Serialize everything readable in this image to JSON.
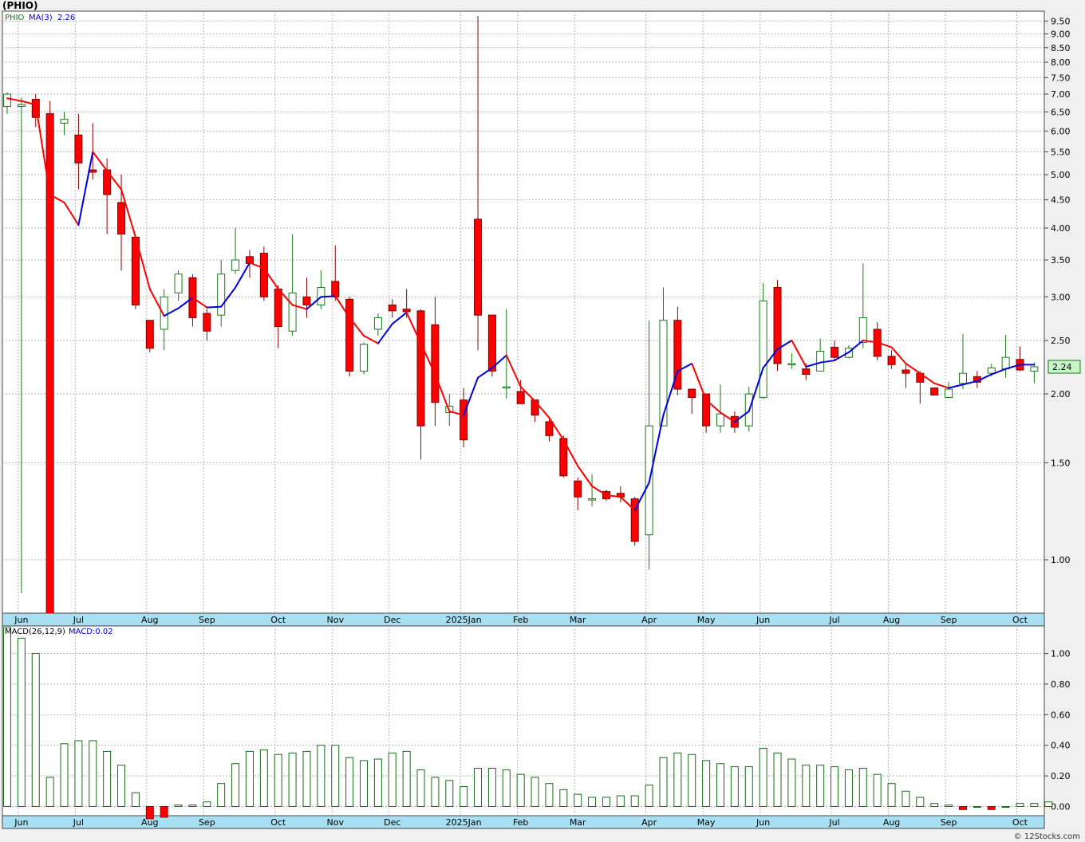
{
  "header": {
    "ticker_label": "(PHIO)"
  },
  "footer": {
    "credit": "© 12Stocks.com"
  },
  "chart_data": [
    {
      "type": "candlestick",
      "legend": {
        "symbol": "PHIO",
        "ma_label": "MA(3)",
        "ma_value": "2.26"
      },
      "last_price_label": "2.24",
      "scale": "log",
      "ylim": [
        0.8,
        9.9
      ],
      "y_ticks": [
        1.0,
        1.5,
        2.0,
        2.5,
        3.0,
        3.5,
        4.0,
        4.5,
        5.0,
        5.5,
        6.0,
        6.5,
        7.0,
        7.5,
        8.0,
        8.5,
        9.0,
        9.5
      ],
      "y_tick_labels": [
        "1.00",
        "1.50",
        "2.00",
        "2.50",
        "3.00",
        "3.50",
        "4.00",
        "4.50",
        "5.00",
        "5.50",
        "6.00",
        "6.50",
        "7.00",
        "7.50",
        "8.00",
        "8.50",
        "9.00",
        "9.50"
      ],
      "x_labels": [
        {
          "label": "Jun",
          "week": 1
        },
        {
          "label": "Jul",
          "week": 5
        },
        {
          "label": "Aug",
          "week": 10
        },
        {
          "label": "Sep",
          "week": 14
        },
        {
          "label": "Oct",
          "week": 19
        },
        {
          "label": "Nov",
          "week": 23
        },
        {
          "label": "Dec",
          "week": 27
        },
        {
          "label": "2025Jan",
          "week": 32
        },
        {
          "label": "Feb",
          "week": 36
        },
        {
          "label": "Mar",
          "week": 40
        },
        {
          "label": "Apr",
          "week": 45
        },
        {
          "label": "May",
          "week": 49
        },
        {
          "label": "Jun",
          "week": 53
        },
        {
          "label": "Jul",
          "week": 58
        },
        {
          "label": "Aug",
          "week": 62
        },
        {
          "label": "Sep",
          "week": 66
        },
        {
          "label": "Oct",
          "week": 71
        }
      ],
      "ohlc": [
        {
          "o": 6.65,
          "h": 7.05,
          "l": 6.45,
          "c": 7.0
        },
        {
          "o": 6.65,
          "h": 6.9,
          "l": 0.87,
          "c": 6.7
        },
        {
          "o": 6.85,
          "h": 7.0,
          "l": 6.1,
          "c": 6.35
        },
        {
          "o": 6.45,
          "h": 6.8,
          "l": 0.75,
          "c": 0.75
        },
        {
          "o": 6.2,
          "h": 6.5,
          "l": 5.9,
          "c": 6.3
        },
        {
          "o": 5.9,
          "h": 6.45,
          "l": 4.7,
          "c": 5.25
        },
        {
          "o": 5.1,
          "h": 6.2,
          "l": 4.9,
          "c": 5.05
        },
        {
          "o": 5.1,
          "h": 5.35,
          "l": 3.9,
          "c": 4.6
        },
        {
          "o": 4.45,
          "h": 5.0,
          "l": 3.35,
          "c": 3.9
        },
        {
          "o": 3.85,
          "h": 3.85,
          "l": 2.85,
          "c": 2.9
        },
        {
          "o": 2.72,
          "h": 2.72,
          "l": 2.38,
          "c": 2.42
        },
        {
          "o": 2.62,
          "h": 3.1,
          "l": 2.4,
          "c": 3.0
        },
        {
          "o": 3.05,
          "h": 3.35,
          "l": 2.95,
          "c": 3.3
        },
        {
          "o": 3.25,
          "h": 3.3,
          "l": 2.65,
          "c": 2.75
        },
        {
          "o": 2.8,
          "h": 2.85,
          "l": 2.5,
          "c": 2.6
        },
        {
          "o": 2.78,
          "h": 3.5,
          "l": 2.65,
          "c": 3.3
        },
        {
          "o": 3.35,
          "h": 4.0,
          "l": 3.3,
          "c": 3.5
        },
        {
          "o": 3.55,
          "h": 3.65,
          "l": 3.25,
          "c": 3.45
        },
        {
          "o": 3.6,
          "h": 3.7,
          "l": 2.95,
          "c": 3.0
        },
        {
          "o": 3.1,
          "h": 3.15,
          "l": 2.42,
          "c": 2.65
        },
        {
          "o": 2.6,
          "h": 3.9,
          "l": 2.55,
          "c": 3.05
        },
        {
          "o": 3.0,
          "h": 3.25,
          "l": 2.75,
          "c": 2.9
        },
        {
          "o": 2.9,
          "h": 3.35,
          "l": 2.85,
          "c": 3.12
        },
        {
          "o": 3.2,
          "h": 3.72,
          "l": 2.95,
          "c": 3.0
        },
        {
          "o": 2.97,
          "h": 3.0,
          "l": 2.15,
          "c": 2.2
        },
        {
          "o": 2.2,
          "h": 2.48,
          "l": 2.17,
          "c": 2.46
        },
        {
          "o": 2.62,
          "h": 2.8,
          "l": 2.55,
          "c": 2.75
        },
        {
          "o": 2.9,
          "h": 2.97,
          "l": 2.75,
          "c": 2.83
        },
        {
          "o": 2.85,
          "h": 3.1,
          "l": 2.75,
          "c": 2.82
        },
        {
          "o": 2.83,
          "h": 2.85,
          "l": 1.52,
          "c": 1.75
        },
        {
          "o": 2.67,
          "h": 3.0,
          "l": 1.75,
          "c": 1.93
        },
        {
          "o": 1.85,
          "h": 2.0,
          "l": 1.75,
          "c": 1.9
        },
        {
          "o": 1.95,
          "h": 2.05,
          "l": 1.6,
          "c": 1.65
        },
        {
          "o": 4.15,
          "h": 9.7,
          "l": 2.4,
          "c": 2.78
        },
        {
          "o": 2.78,
          "h": 2.78,
          "l": 2.15,
          "c": 2.2
        },
        {
          "o": 2.06,
          "h": 2.85,
          "l": 1.96,
          "c": 2.06
        },
        {
          "o": 2.02,
          "h": 2.12,
          "l": 1.92,
          "c": 1.92
        },
        {
          "o": 1.95,
          "h": 1.95,
          "l": 1.78,
          "c": 1.83
        },
        {
          "o": 1.78,
          "h": 1.8,
          "l": 1.64,
          "c": 1.68
        },
        {
          "o": 1.66,
          "h": 1.68,
          "l": 1.41,
          "c": 1.42
        },
        {
          "o": 1.39,
          "h": 1.41,
          "l": 1.23,
          "c": 1.3
        },
        {
          "o": 1.29,
          "h": 1.43,
          "l": 1.25,
          "c": 1.29
        },
        {
          "o": 1.33,
          "h": 1.34,
          "l": 1.28,
          "c": 1.29
        },
        {
          "o": 1.32,
          "h": 1.36,
          "l": 1.27,
          "c": 1.3
        },
        {
          "o": 1.29,
          "h": 1.3,
          "l": 1.06,
          "c": 1.08
        },
        {
          "o": 1.11,
          "h": 2.72,
          "l": 0.96,
          "c": 1.75
        },
        {
          "o": 1.75,
          "h": 3.12,
          "l": 1.75,
          "c": 2.72
        },
        {
          "o": 2.72,
          "h": 2.88,
          "l": 1.99,
          "c": 2.04
        },
        {
          "o": 2.04,
          "h": 2.04,
          "l": 1.84,
          "c": 1.97
        },
        {
          "o": 2.0,
          "h": 2.0,
          "l": 1.7,
          "c": 1.75
        },
        {
          "o": 1.75,
          "h": 2.08,
          "l": 1.7,
          "c": 1.84
        },
        {
          "o": 1.82,
          "h": 1.86,
          "l": 1.7,
          "c": 1.74
        },
        {
          "o": 1.75,
          "h": 2.06,
          "l": 1.71,
          "c": 2.0
        },
        {
          "o": 1.97,
          "h": 3.18,
          "l": 1.96,
          "c": 2.95
        },
        {
          "o": 3.12,
          "h": 3.22,
          "l": 2.2,
          "c": 2.27
        },
        {
          "o": 2.27,
          "h": 2.37,
          "l": 2.22,
          "c": 2.27
        },
        {
          "o": 2.22,
          "h": 2.27,
          "l": 2.12,
          "c": 2.17
        },
        {
          "o": 2.2,
          "h": 2.52,
          "l": 2.2,
          "c": 2.39
        },
        {
          "o": 2.43,
          "h": 2.5,
          "l": 2.3,
          "c": 2.33
        },
        {
          "o": 2.33,
          "h": 2.45,
          "l": 2.32,
          "c": 2.42
        },
        {
          "o": 2.48,
          "h": 3.45,
          "l": 2.42,
          "c": 2.75
        },
        {
          "o": 2.62,
          "h": 2.7,
          "l": 2.3,
          "c": 2.34
        },
        {
          "o": 2.34,
          "h": 2.4,
          "l": 2.22,
          "c": 2.26
        },
        {
          "o": 2.21,
          "h": 2.27,
          "l": 2.05,
          "c": 2.18
        },
        {
          "o": 2.18,
          "h": 2.2,
          "l": 1.92,
          "c": 2.1
        },
        {
          "o": 2.05,
          "h": 2.05,
          "l": 1.99,
          "c": 1.99
        },
        {
          "o": 1.97,
          "h": 2.1,
          "l": 1.97,
          "c": 2.04
        },
        {
          "o": 2.09,
          "h": 2.57,
          "l": 2.04,
          "c": 2.18
        },
        {
          "o": 2.15,
          "h": 2.2,
          "l": 2.05,
          "c": 2.1
        },
        {
          "o": 2.18,
          "h": 2.27,
          "l": 2.15,
          "c": 2.23
        },
        {
          "o": 2.22,
          "h": 2.56,
          "l": 2.14,
          "c": 2.33
        },
        {
          "o": 2.31,
          "h": 2.44,
          "l": 2.2,
          "c": 2.21
        },
        {
          "o": 2.2,
          "h": 2.28,
          "l": 2.09,
          "c": 2.24
        }
      ],
      "ma3": [
        6.88,
        6.8,
        6.7,
        4.6,
        4.45,
        4.05,
        5.5,
        5.08,
        4.7,
        3.85,
        3.1,
        2.77,
        2.86,
        2.99,
        2.87,
        2.88,
        3.12,
        3.46,
        3.38,
        3.1,
        2.9,
        2.85,
        3.0,
        3.01,
        2.75,
        2.55,
        2.47,
        2.68,
        2.81,
        2.47,
        2.17,
        1.86,
        1.83,
        2.14,
        2.23,
        2.35,
        2.06,
        1.94,
        1.81,
        1.65,
        1.48,
        1.36,
        1.31,
        1.3,
        1.23,
        1.38,
        1.83,
        2.2,
        2.27,
        1.95,
        1.85,
        1.78,
        1.86,
        2.23,
        2.41,
        2.5,
        2.24,
        2.28,
        2.3,
        2.38,
        2.5,
        2.48,
        2.43,
        2.27,
        2.18,
        2.09,
        2.05,
        2.08,
        2.11,
        2.17,
        2.22,
        2.26,
        2.26
      ],
      "ma3_colors": [
        "red",
        "red",
        "red",
        "red",
        "red",
        "red",
        "blue",
        "red",
        "red",
        "red",
        "red",
        "red",
        "blue",
        "blue",
        "red",
        "blue",
        "blue",
        "blue",
        "red",
        "red",
        "red",
        "red",
        "blue",
        "blue",
        "red",
        "red",
        "red",
        "blue",
        "blue",
        "red",
        "red",
        "red",
        "red",
        "blue",
        "blue",
        "blue",
        "red",
        "red",
        "red",
        "red",
        "red",
        "red",
        "red",
        "red",
        "red",
        "blue",
        "blue",
        "blue",
        "blue",
        "red",
        "red",
        "red",
        "blue",
        "blue",
        "blue",
        "blue",
        "red",
        "blue",
        "blue",
        "blue",
        "blue",
        "red",
        "red",
        "red",
        "red",
        "red",
        "red",
        "blue",
        "blue",
        "blue",
        "blue",
        "blue",
        "blue"
      ]
    },
    {
      "type": "bar",
      "legend": {
        "label": "MACD(26,12,9)",
        "value_label": "MACD:0.02"
      },
      "ylim": [
        -0.06,
        1.18
      ],
      "y_ticks": [
        0.0,
        0.2,
        0.4,
        0.6,
        0.8,
        1.0
      ],
      "y_tick_labels": [
        "0.00",
        "0.20",
        "0.40",
        "0.60",
        "0.80",
        "1.00"
      ],
      "values": [
        1.17,
        1.1,
        1.0,
        0.19,
        0.41,
        0.43,
        0.43,
        0.36,
        0.27,
        0.09,
        -0.08,
        -0.07,
        0.01,
        0.01,
        0.03,
        0.15,
        0.28,
        0.36,
        0.37,
        0.34,
        0.35,
        0.36,
        0.4,
        0.4,
        0.32,
        0.3,
        0.31,
        0.35,
        0.36,
        0.24,
        0.19,
        0.17,
        0.13,
        0.25,
        0.25,
        0.24,
        0.21,
        0.19,
        0.15,
        0.11,
        0.08,
        0.06,
        0.06,
        0.07,
        0.07,
        0.14,
        0.32,
        0.35,
        0.34,
        0.3,
        0.28,
        0.26,
        0.26,
        0.38,
        0.35,
        0.31,
        0.27,
        0.27,
        0.26,
        0.24,
        0.25,
        0.21,
        0.15,
        0.1,
        0.06,
        0.02,
        0.01,
        -0.02,
        0.0,
        -0.02,
        0.0,
        0.02,
        0.02,
        0.03
      ]
    }
  ]
}
